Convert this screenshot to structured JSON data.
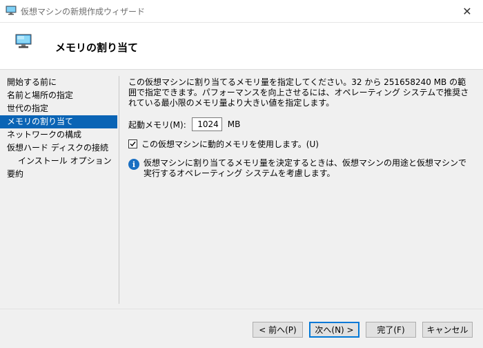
{
  "window": {
    "title": "仮想マシンの新規作成ウィザード",
    "close_glyph": "✕"
  },
  "header": {
    "title": "メモリの割り当て"
  },
  "nav": {
    "items": [
      {
        "label": "開始する前に",
        "active": false,
        "sub": false
      },
      {
        "label": "名前と場所の指定",
        "active": false,
        "sub": false
      },
      {
        "label": "世代の指定",
        "active": false,
        "sub": false
      },
      {
        "label": "メモリの割り当て",
        "active": true,
        "sub": false
      },
      {
        "label": "ネットワークの構成",
        "active": false,
        "sub": false
      },
      {
        "label": "仮想ハード ディスクの接続",
        "active": false,
        "sub": false
      },
      {
        "label": "インストール オプション",
        "active": false,
        "sub": true
      },
      {
        "label": "要約",
        "active": false,
        "sub": false
      }
    ]
  },
  "content": {
    "description": "この仮想マシンに割り当てるメモリ量を指定してください。32 から 251658240 MB の範囲で指定できます。パフォーマンスを向上させるには、オペレーティング システムで推奨されている最小限のメモリ量より大きい値を指定します。",
    "startup_memory_label": "起動メモリ(M):",
    "startup_memory_value": "1024",
    "startup_memory_unit": "MB",
    "dynamic_memory_label": "この仮想マシンに動的メモリを使用します。(U)",
    "dynamic_memory_checked": true,
    "info_text": "仮想マシンに割り当てるメモリ量を決定するときは、仮想マシンの用途と仮想マシンで実行するオペレーティング システムを考慮します。"
  },
  "buttons": {
    "prev": "< 前へ(P)",
    "next": "次へ(N) >",
    "finish": "完了(F)",
    "cancel": "キャンセル"
  },
  "colors": {
    "accent": "#0a64b5",
    "info": "#1a6fc2"
  },
  "icons": {
    "window": "vm-monitor-icon",
    "header": "vm-monitor-icon",
    "info": "info-icon",
    "check": "checkmark-icon"
  }
}
